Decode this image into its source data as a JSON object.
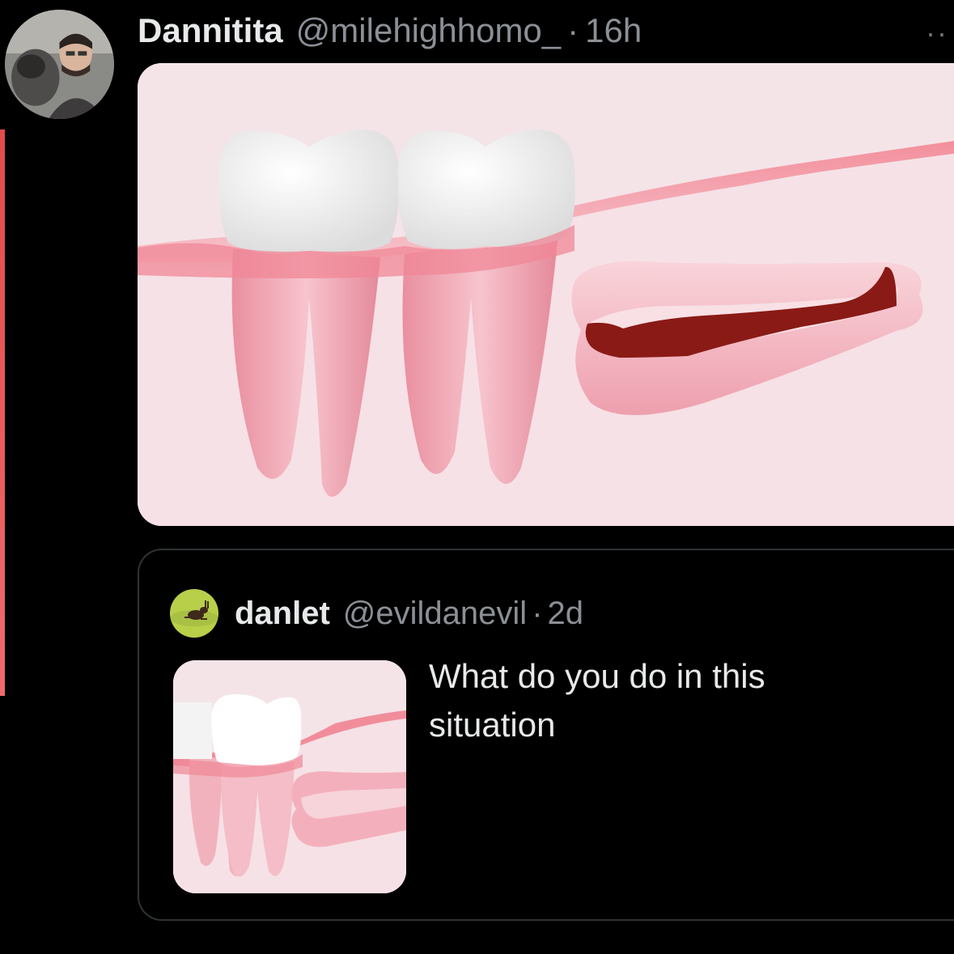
{
  "post": {
    "author_name": "Dannitita",
    "author_handle": "@milehighhomo_",
    "separator": "·",
    "time": "16h",
    "more_label": "··",
    "media_icon": "wisdom-tooth-illustration-edited"
  },
  "quoted_post": {
    "author_name": "danlet",
    "author_handle": "@evildanevil",
    "separator": "·",
    "time": "2d",
    "text": "What do you do in this situation",
    "media_icon": "wisdom-tooth-illustration"
  },
  "colors": {
    "background": "#000000",
    "text_primary": "#e7e9ea",
    "text_secondary": "#8b9096",
    "border": "#2f3336",
    "gum": "#f2a0ae",
    "blood": "#8a1a15"
  }
}
